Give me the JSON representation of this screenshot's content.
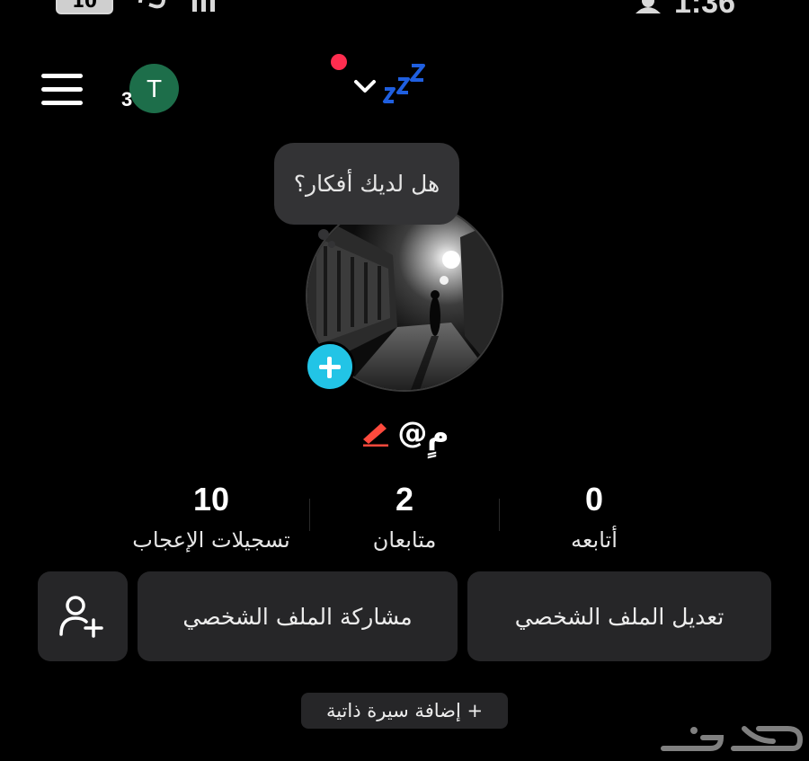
{
  "status_bar": {
    "battery": "10",
    "time": "1:36"
  },
  "header": {
    "friend_requests_count": "3",
    "avatar_initial": "T"
  },
  "bubble": {
    "text": "هل لديك أفكار؟"
  },
  "profile": {
    "username": "@مٍ"
  },
  "stats": [
    {
      "value": "10",
      "label": "تسجيلات الإعجاب"
    },
    {
      "value": "2",
      "label": "متابعان"
    },
    {
      "value": "0",
      "label": "أتابعه"
    }
  ],
  "buttons": {
    "share_profile": "مشاركة الملف الشخصي",
    "edit_profile": "تعديل الملف الشخصي",
    "add_bio": "+ إضافة سيرة ذاتية"
  },
  "watermark": {
    "text": "حراج"
  },
  "colors": {
    "background": "#000000",
    "button_bg": "#262628",
    "add_photo_accent": "#22c4e6",
    "notification_dot": "#ff2d4f",
    "avatar_bg": "#1d6e4a",
    "zzz": "#1f5fe0",
    "pencil": "#ff4a3d"
  }
}
